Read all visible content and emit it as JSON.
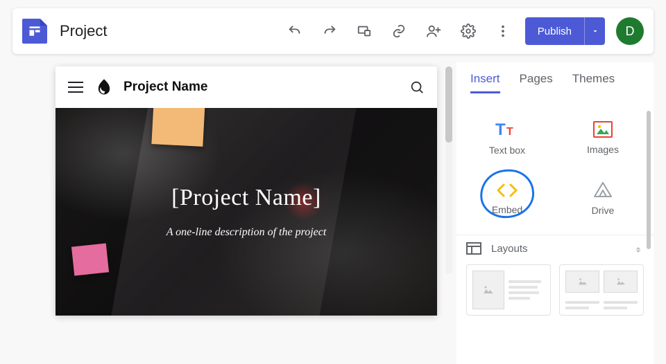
{
  "app": {
    "doc_title": "Project"
  },
  "toolbar": {
    "publish_label": "Publish",
    "avatar_initial": "D"
  },
  "site": {
    "name": "Project Name",
    "hero_title": "[Project Name]",
    "hero_subtitle": "A one-line description of the project"
  },
  "panel": {
    "tabs": {
      "insert": "Insert",
      "pages": "Pages",
      "themes": "Themes",
      "active": "insert"
    },
    "insert": {
      "text_box": "Text box",
      "images": "Images",
      "embed": "Embed",
      "drive": "Drive"
    },
    "layouts_label": "Layouts"
  }
}
